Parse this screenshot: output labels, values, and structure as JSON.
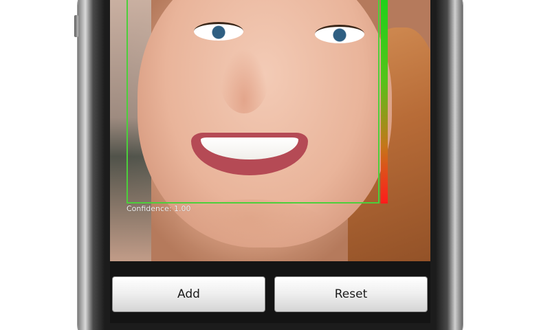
{
  "camera_view": {
    "confidence_label": "Confidence: 1.00",
    "confidence_level": 1.0
  },
  "buttons": {
    "add_label": "Add",
    "reset_label": "Reset"
  },
  "colors": {
    "detection_box": "#4ccf3b",
    "confidence_high": "#1fd11a",
    "confidence_low": "#ff1b1b",
    "button_bar": "#141414"
  }
}
